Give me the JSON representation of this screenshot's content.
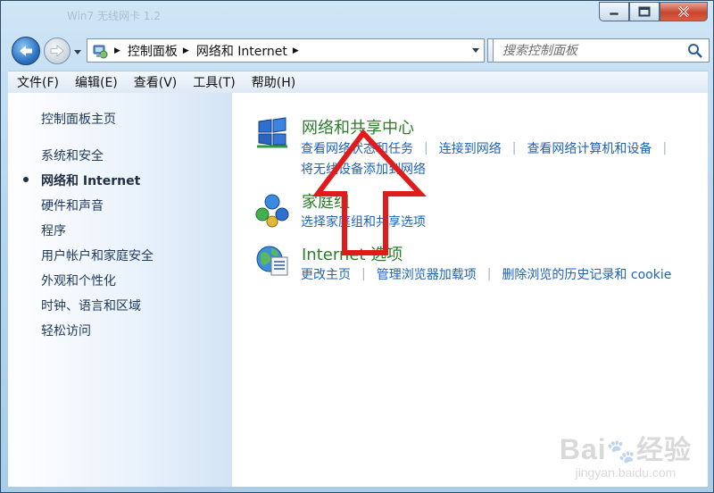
{
  "window": {
    "ghost_title": "Win7 无线网卡 1.2"
  },
  "address": {
    "crumbs": [
      "控制面板",
      "网络和 Internet"
    ]
  },
  "search": {
    "placeholder": "搜索控制面板"
  },
  "menu": [
    "文件(F)",
    "编辑(E)",
    "查看(V)",
    "工具(T)",
    "帮助(H)"
  ],
  "sidebar": {
    "home": "控制面板主页",
    "items": [
      "系统和安全",
      "网络和 Internet",
      "硬件和声音",
      "程序",
      "用户帐户和家庭安全",
      "外观和个性化",
      "时钟、语言和区域",
      "轻松访问"
    ],
    "active_index": 1
  },
  "categories": [
    {
      "title": "网络和共享中心",
      "icon": "network-sharing-icon",
      "tasks": [
        "查看网络状态和任务",
        "连接到网络",
        "查看网络计算机和设备",
        "将无线设备添加到网络"
      ]
    },
    {
      "title": "家庭组",
      "icon": "homegroup-icon",
      "tasks": [
        "选择家庭组和共享选项"
      ]
    },
    {
      "title": "Internet 选项",
      "icon": "internet-options-icon",
      "tasks": [
        "更改主页",
        "管理浏览器加载项",
        "删除浏览的历史记录和 cookie"
      ]
    }
  ],
  "watermark": {
    "logo": "Bai",
    "logo_cn": "经验",
    "sub": "jingyan.baidu.com"
  },
  "colors": {
    "link": "#1e63b8",
    "category_title": "#2a7d2a",
    "annotation_arrow": "#e01b1b"
  }
}
